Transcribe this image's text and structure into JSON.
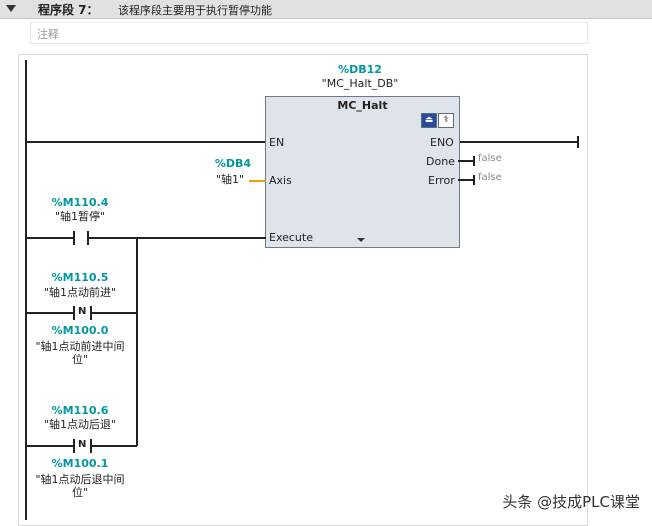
{
  "header": {
    "segment_title": "程序段 7：",
    "segment_desc": "该程序段主要用于执行暂停功能"
  },
  "comment": {
    "placeholder": "注释"
  },
  "block": {
    "instance_addr": "%DB12",
    "instance_name": "\"MC_Halt_DB\"",
    "title": "MC_Halt",
    "pins": {
      "en": "EN",
      "eno": "ENO",
      "axis": "Axis",
      "execute": "Execute",
      "done": "Done",
      "error": "Error"
    },
    "done_value": "false",
    "error_value": "false"
  },
  "axis_param": {
    "addr": "%DB4",
    "name": "\"轴1\""
  },
  "contacts": [
    {
      "addr": "%M110.4",
      "name": "\"轴1暂停\""
    },
    {
      "addr": "%M110.5",
      "name": "\"轴1点动前进\"",
      "type": "N",
      "mem_addr": "%M100.0",
      "mem_name_1": "\"轴1点动前进中间",
      "mem_name_2": "位\""
    },
    {
      "addr": "%M110.6",
      "name": "\"轴1点动后退\"",
      "type": "N",
      "mem_addr": "%M100.1",
      "mem_name_1": "\"轴1点动后退中间",
      "mem_name_2": "位\""
    }
  ],
  "watermark": "头条 @技成PLC课堂"
}
